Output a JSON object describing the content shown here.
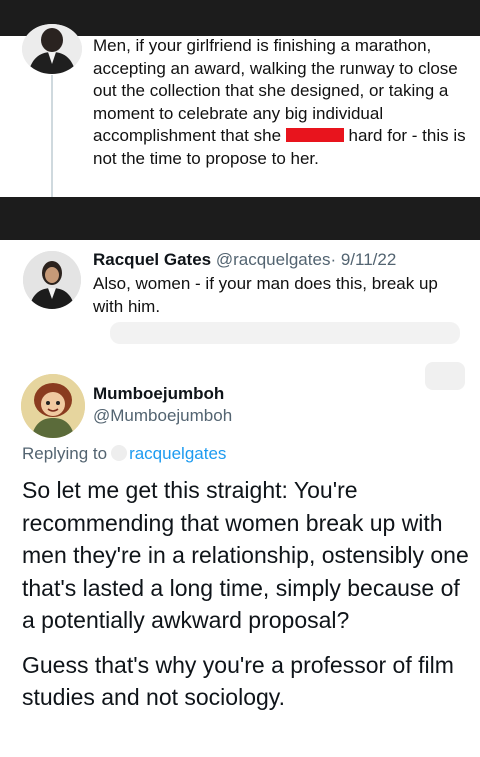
{
  "tweet1": {
    "text_before_redaction": "Men, if your girlfriend is finishing a marathon, accepting an award, walking the runway to close out the collection that she designed, or taking a moment to celebrate any big individual accomplishment that she ",
    "text_after_redaction": " hard for - this is not the time to propose to her."
  },
  "tweet2": {
    "name": "Racquel Gates",
    "handle": "@racquelgates",
    "date": "· 9/11/22",
    "text": "Also, women - if your man does this, break up with him."
  },
  "tweet3": {
    "name": "Mumboejumboh",
    "handle": "@Mumboejumboh",
    "replying_label": "Replying to",
    "replying_handle": "racquelgates",
    "paragraph1": "So let me get this straight: You're recommending that women break up with men they're in a relationship, ostensibly one that's lasted a long time, simply because of a potentially awkward proposal?",
    "paragraph2": "Guess that's why you're a professor of film studies and not sociology."
  },
  "colors": {
    "redaction": "#e8141d",
    "dark_bar": "#1c1c1c",
    "link": "#1d9bf0",
    "muted": "#536471"
  }
}
